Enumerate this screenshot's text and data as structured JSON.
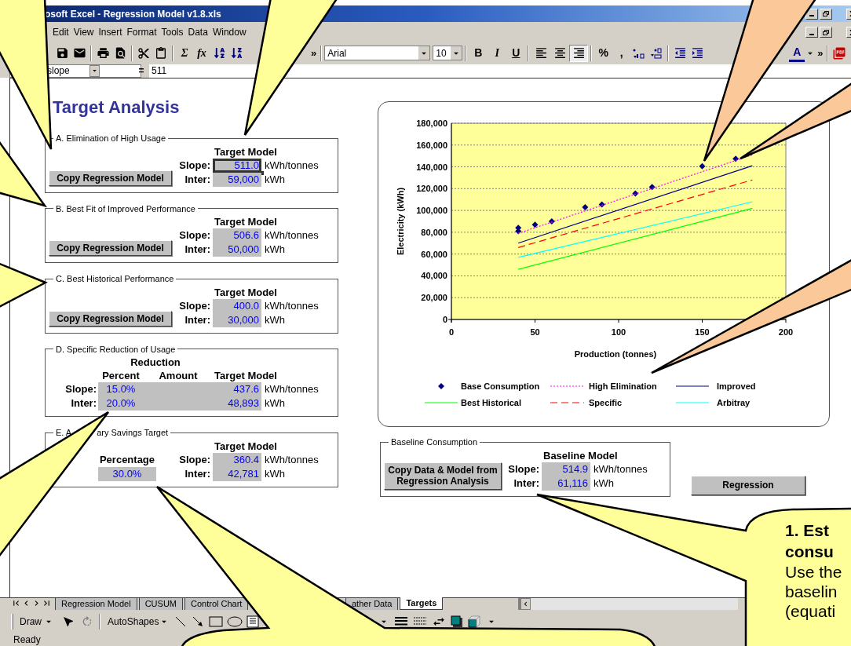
{
  "window": {
    "title": "osoft Excel - Regression Model v1.8.xls"
  },
  "menu": [
    "Edit",
    "View",
    "Insert",
    "Format",
    "Tools",
    "Data",
    "Window"
  ],
  "toolbar": {
    "function_buttons": [
      "Σ",
      "fx"
    ],
    "overflow": "»",
    "font": "Arial",
    "size": "10",
    "format_buttons": [
      "B",
      "I",
      "U"
    ],
    "alignments": [
      {
        "selected": false
      },
      {
        "selected": false
      },
      {
        "selected": true
      }
    ],
    "number_buttons": [
      "%",
      ","
    ],
    "font_color": "A",
    "overflow_right": "»"
  },
  "formula_bar": {
    "name_box": "slope",
    "equals": "=",
    "value": "511"
  },
  "sheet": {
    "title": "Target Analysis",
    "panels": [
      {
        "kind": "model",
        "title": "A. Elimination of High Usage",
        "button": "Copy Regression Model",
        "header": "Target Model",
        "rows": [
          {
            "label": "Slope:",
            "value": "511.0",
            "unit": "kWh/tonnes",
            "selected": true
          },
          {
            "label": "Inter:",
            "value": "59,000",
            "unit": "kWh",
            "selected": false
          }
        ]
      },
      {
        "kind": "model",
        "title": "B. Best Fit of Improved Performance",
        "button": "Copy Regression Model",
        "header": "Target Model",
        "rows": [
          {
            "label": "Slope:",
            "value": "506.6",
            "unit": "kWh/tonnes",
            "selected": false
          },
          {
            "label": "Inter:",
            "value": "50,000",
            "unit": "kWh",
            "selected": false
          }
        ]
      },
      {
        "kind": "model",
        "title": "C. Best Historical Performance",
        "button": "Copy Regression Model",
        "header": "Target Model",
        "rows": [
          {
            "label": "Slope:",
            "value": "400.0",
            "unit": "kWh/tonnes",
            "selected": false
          },
          {
            "label": "Inter:",
            "value": "30,000",
            "unit": "kWh",
            "selected": false
          }
        ]
      },
      {
        "kind": "reduction",
        "title": "D. Specific Reduction of Usage",
        "group_header": "Reduction",
        "columns": [
          "Percent",
          "Amount",
          "Target Model"
        ],
        "rows": [
          {
            "label": "Slope:",
            "percent": "15.0%",
            "value": "437.6",
            "unit": "kWh/tonnes",
            "selected": false
          },
          {
            "label": "Inter:",
            "percent": "20.0%",
            "value": "48,893",
            "unit": "kWh",
            "selected": false
          }
        ]
      },
      {
        "kind": "savings",
        "title_parts": [
          "E. A",
          "ary Savings Target"
        ],
        "percentage_label": "Percentage",
        "percentage": "30.0%",
        "header": "Target Model",
        "rows": [
          {
            "label": "Slope:",
            "value": "360.4",
            "unit": "kWh/tonnes",
            "selected": false
          },
          {
            "label": "Inter:",
            "value": "42,781",
            "unit": "kWh",
            "selected": false
          }
        ]
      }
    ],
    "chart": {
      "chart_data": {
        "type": "scatter",
        "xlabel": "Production (tonnes)",
        "ylabel": "Electricity (kWh)",
        "grid": true,
        "legend": "bottom",
        "xlim": [
          0,
          200
        ],
        "ylim": [
          0,
          180000
        ],
        "xticks": [
          0,
          50,
          100,
          150,
          200
        ],
        "yticks": [
          {
            "value": 0,
            "label": "0"
          },
          {
            "value": 20000,
            "label": "20,000"
          },
          {
            "value": 40000,
            "label": "40,000"
          },
          {
            "value": 60000,
            "label": "60,000"
          },
          {
            "value": 80000,
            "label": "80,000"
          },
          {
            "value": 100000,
            "label": "100,000"
          },
          {
            "value": 120000,
            "label": "120,000"
          },
          {
            "value": 140000,
            "label": "140,000"
          },
          {
            "value": 160000,
            "label": "160,000"
          },
          {
            "value": 180000,
            "label": "180,000"
          }
        ],
        "series": [
          {
            "name": "Base Consumption",
            "type": "scatter",
            "color": "#000080",
            "x": [
              40,
              40,
              50,
              60,
              80,
              90,
              110,
              120,
              150,
              170
            ],
            "values": [
              84000,
              81000,
              87000,
              90000,
              103000,
              105500,
              115500,
              121500,
              140500,
              147500
            ]
          },
          {
            "name": "High Elimination",
            "type": "line",
            "line_style": "dotted",
            "color": "#ff00ff",
            "x": [
              40,
              180
            ],
            "values": [
              79000,
              151000
            ]
          },
          {
            "name": "Improved",
            "type": "line",
            "line_style": "solid",
            "color": "#000080",
            "x": [
              40,
              180
            ],
            "values": [
              70000,
              141000
            ]
          },
          {
            "name": "Best Historical",
            "type": "line",
            "line_style": "solid",
            "color": "#00ff00",
            "x": [
              40,
              180
            ],
            "values": [
              46000,
              102000
            ]
          },
          {
            "name": "Specific",
            "type": "line",
            "line_style": "dashed",
            "color": "#ff0000",
            "x": [
              40,
              180
            ],
            "values": [
              66000,
              128000
            ]
          },
          {
            "name": "Arbitray",
            "type": "line",
            "line_style": "solid",
            "color": "#00ffff",
            "x": [
              40,
              180
            ],
            "values": [
              57000,
              108000
            ]
          }
        ]
      }
    },
    "baseline": {
      "title": "Baseline Consumption",
      "button": "Copy Data & Model from Regression Analysis",
      "header": "Baseline Model",
      "rows": [
        {
          "label": "Slope:",
          "value": "514.9",
          "unit": "kWh/tonnes",
          "selected": false
        },
        {
          "label": "Inter:",
          "value": "61,116",
          "unit": "kWh",
          "selected": false
        }
      ]
    },
    "regression_button": "Regression"
  },
  "sheet_tabs": {
    "left": [
      {
        "label": "Regression Model",
        "selected": false
      },
      {
        "label": "CUSUM",
        "selected": false
      },
      {
        "label": "Control Chart",
        "selected": false
      }
    ],
    "right": [
      {
        "label": "ather Data",
        "selected": false
      },
      {
        "label": "Targets",
        "selected": true
      }
    ]
  },
  "drawing_toolbar": {
    "draw": "Draw",
    "autoshapes": "AutoShapes"
  },
  "status_bar": {
    "text": "Ready"
  },
  "callout": {
    "heading_lines": [
      "1. Est",
      "consu"
    ],
    "body_lines": [
      "Use the",
      "baselin",
      "(equati"
    ]
  }
}
